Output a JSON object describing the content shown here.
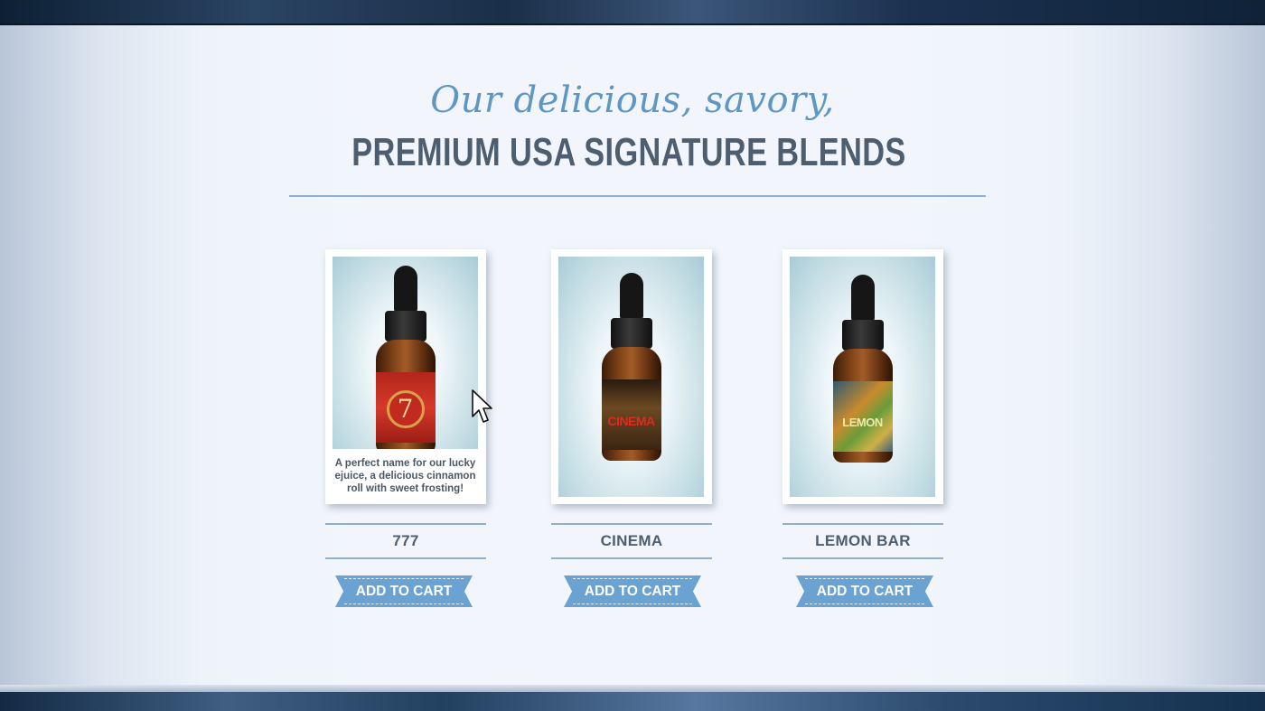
{
  "header": {
    "script_title": "Our delicious, savory,",
    "main_title": "PREMIUM USA SIGNATURE BLENDS"
  },
  "products": [
    {
      "name": "777",
      "description": "A perfect  name for our lucky ejuice, a delicious cinnamon roll with sweet frosting!",
      "label_text": "7",
      "cart_label": "ADD TO CART"
    },
    {
      "name": "CINEMA",
      "label_text": "CINEMA",
      "cart_label": "ADD TO CART"
    },
    {
      "name": "LEMON BAR",
      "label_text": "LEMON",
      "cart_label": "ADD TO CART"
    }
  ],
  "colors": {
    "accent_blue": "#6aa2d1",
    "title_slate": "#4d5e70",
    "script_blue": "#5e97c4",
    "rule": "#8fb1cf"
  },
  "icons": [
    "mouse-pointer-icon"
  ]
}
